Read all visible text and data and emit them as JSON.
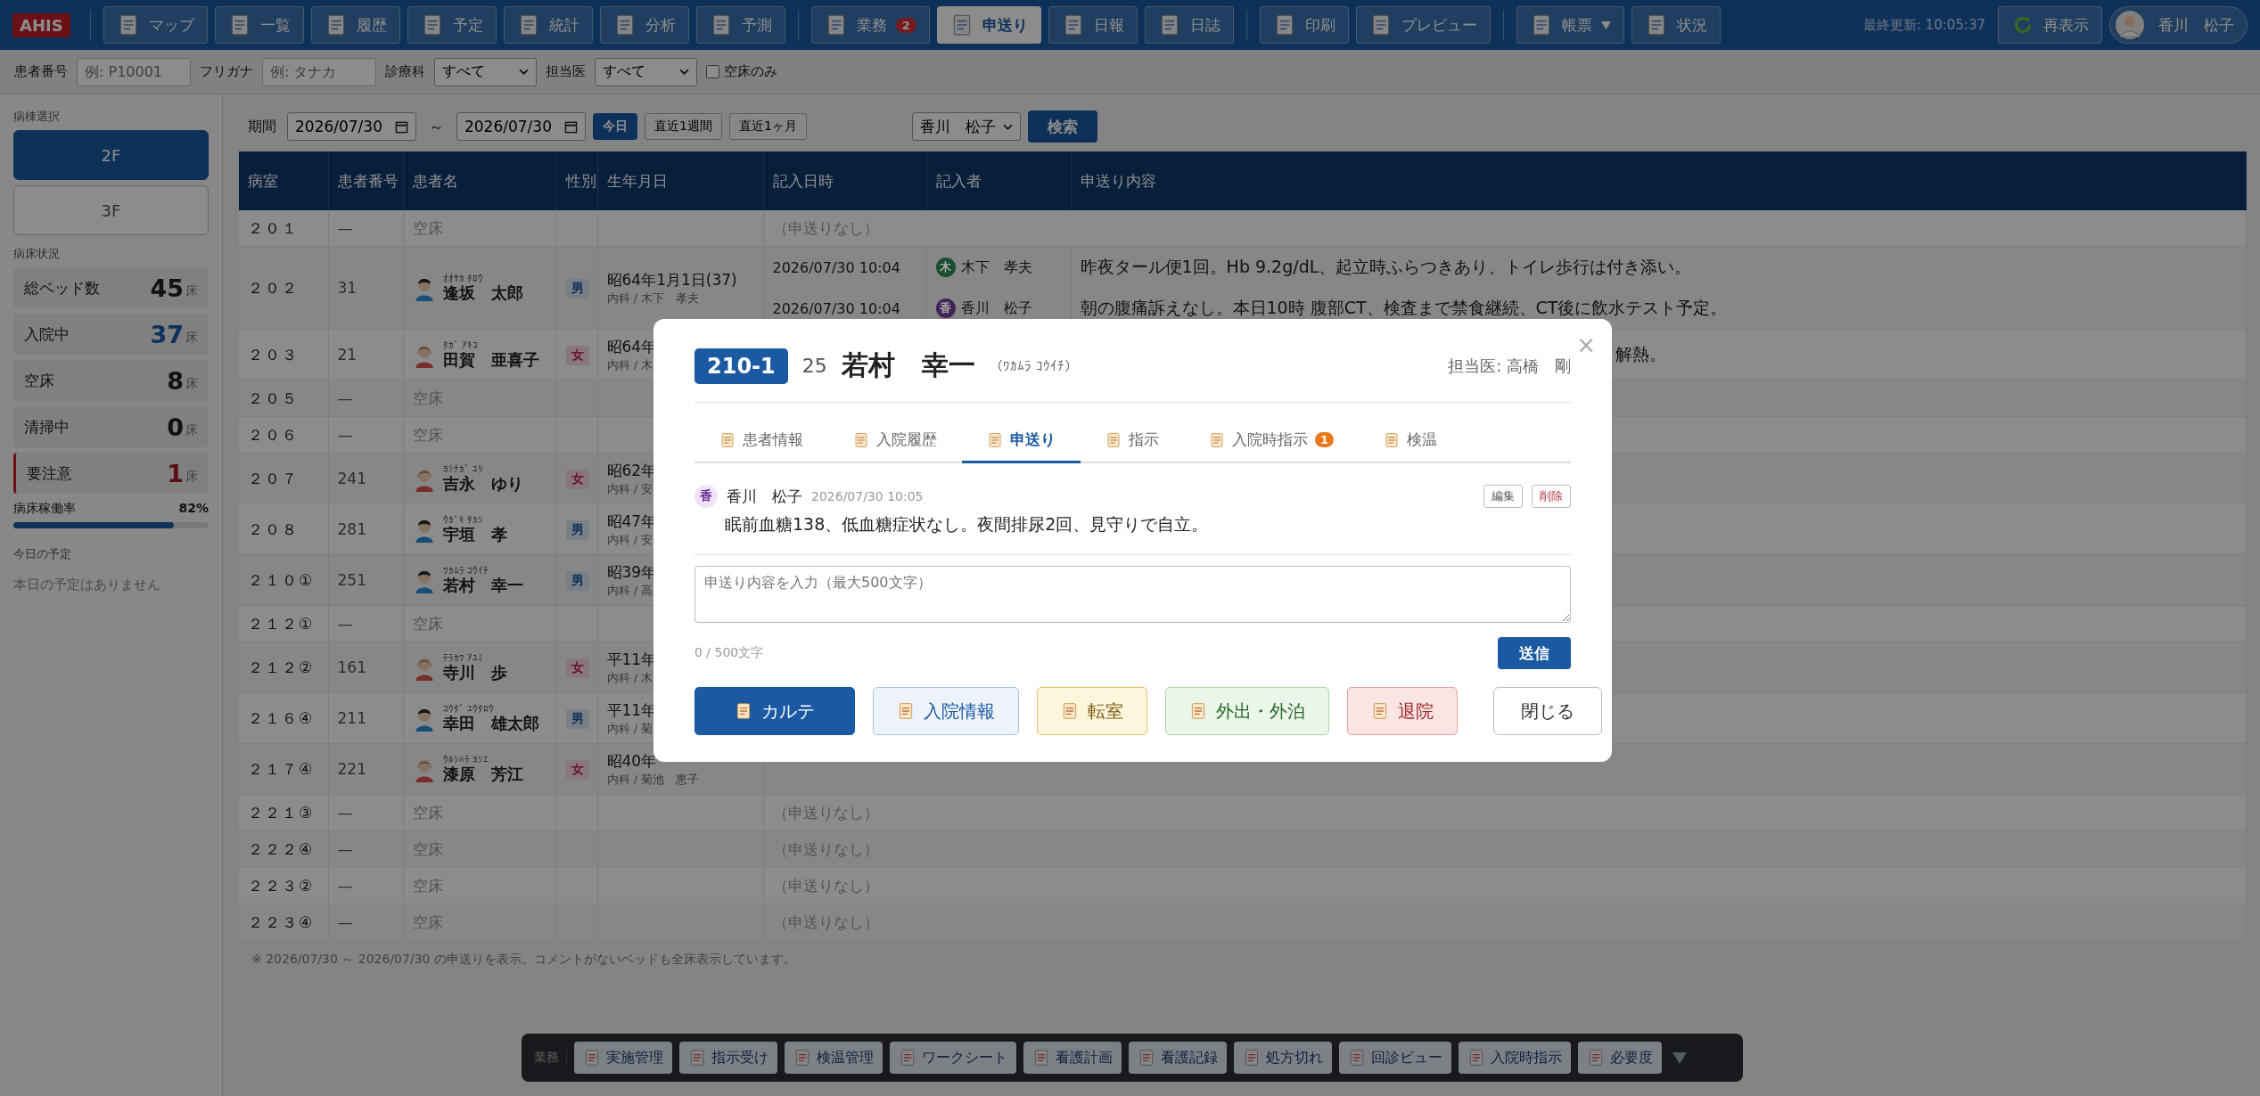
{
  "topbar": {
    "logo": "AHIS",
    "groups": [
      [
        {
          "label": "マップ",
          "kind": "button",
          "selected": false
        },
        {
          "label": "一覧",
          "kind": "button",
          "selected": false
        },
        {
          "label": "履歴",
          "kind": "button",
          "selected": false
        },
        {
          "label": "予定",
          "kind": "button",
          "selected": false
        },
        {
          "label": "統計",
          "kind": "button",
          "selected": false
        },
        {
          "label": "分析",
          "kind": "button",
          "selected": false
        },
        {
          "label": "予測",
          "kind": "button",
          "selected": false
        }
      ],
      [
        {
          "label": "業務",
          "kind": "button",
          "selected": false,
          "badge": "2"
        },
        {
          "label": "申送り",
          "kind": "button",
          "selected": true
        },
        {
          "label": "日報",
          "kind": "button",
          "selected": false
        },
        {
          "label": "日誌",
          "kind": "button",
          "selected": false
        }
      ],
      [
        {
          "label": "印刷",
          "kind": "button",
          "selected": false
        },
        {
          "label": "プレビュー",
          "kind": "button",
          "selected": false
        }
      ],
      [
        {
          "label": "帳票",
          "kind": "dropdown",
          "selected": false
        },
        {
          "label": "状況",
          "kind": "button",
          "selected": false
        }
      ]
    ],
    "last_updated": "最終更新: 10:05:37",
    "refresh": "再表示",
    "user": "香川　松子"
  },
  "filters": [
    {
      "label": "患者番号",
      "kind": "input",
      "placeholder": "例: P10001"
    },
    {
      "label": "フリガナ",
      "kind": "input",
      "placeholder": "例: タナカ"
    },
    {
      "label": "診療科",
      "kind": "select",
      "value": "すべて"
    },
    {
      "label": "担当医",
      "kind": "select",
      "value": "すべて"
    },
    {
      "label": "空床のみ",
      "kind": "checkbox",
      "checked": false
    }
  ],
  "sidebar": {
    "ward_title": "病棟選択",
    "wards": [
      {
        "label": "2F",
        "selected": true
      },
      {
        "label": "3F",
        "selected": false
      }
    ],
    "status_title": "病床状況",
    "stats": [
      {
        "label": "総ベッド数",
        "value": "45",
        "unit": "床",
        "kind": "normal"
      },
      {
        "label": "入院中",
        "value": "37",
        "unit": "床",
        "kind": "primary"
      },
      {
        "label": "空床",
        "value": "8",
        "unit": "床",
        "kind": "normal"
      },
      {
        "label": "清掃中",
        "value": "0",
        "unit": "床",
        "kind": "normal"
      },
      {
        "label": "要注意",
        "value": "1",
        "unit": "床",
        "kind": "alert"
      }
    ],
    "occupancy": {
      "label": "病床稼働率",
      "reading": "82%",
      "level": 0.82
    },
    "schedule_title": "今日の予定",
    "schedule_empty": "本日の予定はありません"
  },
  "search": {
    "period_label": "期間",
    "from": "2026/07/30",
    "separator": "～",
    "to": "2026/07/30",
    "ranges": [
      {
        "label": "今日",
        "selected": true
      },
      {
        "label": "直近1週間",
        "selected": false
      },
      {
        "label": "直近1ヶ月",
        "selected": false
      }
    ],
    "staff": "香川　松子",
    "button": "検索"
  },
  "table": {
    "columns": [
      "病室",
      "患者番号",
      "患者名",
      "性別",
      "生年月日",
      "記入日時",
      "記入者",
      "申送り内容"
    ],
    "rows": [
      {
        "room": "２０１",
        "number": "—",
        "kind": "empty",
        "name": "空床",
        "record": "（申送りなし）"
      },
      {
        "room": "２０２",
        "number": "31",
        "kind": "male",
        "kana": "ｵｵｻｶ ﾀﾛｳ",
        "name": "逢坂　太郎",
        "sex": "男",
        "birth": "昭64年1月1日(37)",
        "sub": "内科 / 木下　孝夫",
        "entries": [
          {
            "kind": "full",
            "time": "2026/07/30 10:04",
            "initial": "木",
            "color": "#194d30",
            "author": "木下　孝夫",
            "text": "昨夜タール便1回。Hb 9.2g/dL、起立時ふらつきあり、トイレ歩行は付き添い。"
          },
          {
            "kind": "full",
            "time": "2026/07/30 10:04",
            "initial": "香",
            "color": "#442358",
            "author": "香川　松子",
            "text": "朝の腹痛訴えなし。本日10時 腹部CT、検査まで禁食継続、CT後に飲水テスト予定。"
          }
        ]
      },
      {
        "room": "２０３",
        "number": "21",
        "kind": "female",
        "kana": "ﾀｶﾞ ｱｷｺ",
        "name": "田賀　亜喜子",
        "sex": "女",
        "birth": "昭64年",
        "sub": "内科 / 木",
        "entries": [
          {
            "kind": "clipped",
            "text": "解熱。"
          }
        ]
      },
      {
        "room": "２０５",
        "number": "—",
        "kind": "empty",
        "name": "空床"
      },
      {
        "room": "２０６",
        "number": "—",
        "kind": "empty",
        "name": "空床"
      },
      {
        "room": "２０７",
        "number": "241",
        "kind": "female",
        "kana": "ﾖｼﾅｶﾞ ﾕﾘ",
        "name": "吉永　ゆり",
        "sex": "女",
        "birth": "昭62年",
        "sub": "内科 / 安"
      },
      {
        "room": "２０８",
        "number": "281",
        "kind": "male",
        "kana": "ｳｶﾞｷ ﾀｶｼ",
        "name": "宇垣　孝",
        "sex": "男",
        "birth": "昭47年",
        "sub": "内科 / 安"
      },
      {
        "room": "２１０①",
        "number": "251",
        "kind": "male",
        "kana": "ﾜｶﾑﾗ ｺｳｲﾁ",
        "name": "若村　幸一",
        "sex": "男",
        "birth": "昭39年",
        "sub": "内科 / 高"
      },
      {
        "room": "２１２①",
        "number": "—",
        "kind": "empty",
        "name": "空床"
      },
      {
        "room": "２１２②",
        "number": "161",
        "kind": "female",
        "kana": "ﾃﾗｶﾜ ｱﾕﾐ",
        "name": "寺川　歩",
        "sex": "女",
        "birth": "平11年",
        "sub": "内科 / 木"
      },
      {
        "room": "２１６④",
        "number": "211",
        "kind": "male",
        "kana": "ｺｳﾀﾞ ﾕｳﾀﾛｳ",
        "name": "幸田　雄太郎",
        "sex": "男",
        "birth": "平11年",
        "sub": "内科 / 菊"
      },
      {
        "room": "２１７④",
        "number": "221",
        "kind": "female",
        "kana": "ｳﾙｼﾊﾗ ﾖｼｴ",
        "name": "漆原　芳江",
        "sex": "女",
        "birth": "昭40年",
        "sub": "内科 / 菊池　恵子"
      },
      {
        "room": "２２１③",
        "number": "—",
        "kind": "empty",
        "name": "空床",
        "record": "（申送りなし）"
      },
      {
        "room": "２２２④",
        "number": "—",
        "kind": "empty",
        "name": "空床",
        "record": "（申送りなし）"
      },
      {
        "room": "２２３②",
        "number": "—",
        "kind": "empty",
        "name": "空床",
        "record": "（申送りなし）"
      },
      {
        "room": "２２３④",
        "number": "—",
        "kind": "empty",
        "name": "空床",
        "record": "（申送りなし）"
      }
    ],
    "note": "※ 2026/07/30 ～ 2026/07/30 の申送りを表示。コメントがないベッドも全床表示しています。"
  },
  "modal": {
    "room": "210-1",
    "number": "25",
    "name": "若村　幸一",
    "kana": "（ﾜｶﾑﾗ ｺｳｲﾁ）",
    "doctor": "担当医: 高橋　剛",
    "close": "×",
    "tabs": [
      {
        "label": "患者情報",
        "selected": false
      },
      {
        "label": "入院履歴",
        "selected": false
      },
      {
        "label": "申送り",
        "selected": true
      },
      {
        "label": "指示",
        "selected": false
      },
      {
        "label": "入院時指示",
        "selected": false,
        "badge": "1"
      },
      {
        "label": "検温",
        "selected": false
      }
    ],
    "note": {
      "initial": "香",
      "author": "香川　松子",
      "time": "2026/07/30 10:05",
      "edit": "編集",
      "delete": "削除",
      "text": "眠前血糖138、低血糖症状なし。夜間排尿2回、見守りで自立。"
    },
    "input": {
      "placeholder": "申送り内容を入力（最大500文字）",
      "counter": "0 / 500文字",
      "send": "送信"
    },
    "actions": [
      {
        "label": "カルテ",
        "kind": "primary"
      },
      {
        "label": "入院情報",
        "kind": "info"
      },
      {
        "label": "転室",
        "kind": "warning"
      },
      {
        "label": "外出・外泊",
        "kind": "success"
      },
      {
        "label": "退院",
        "kind": "danger"
      }
    ],
    "close_button": "閉じる"
  },
  "dock": {
    "label": "業務",
    "buttons": [
      "実施管理",
      "指示受け",
      "検温管理",
      "ワークシート",
      "看護計画",
      "看護記録",
      "処方切れ",
      "回診ビュー",
      "入院時指示",
      "必要度"
    ]
  }
}
